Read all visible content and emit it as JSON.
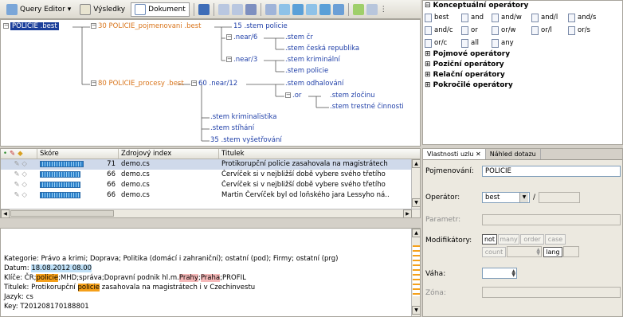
{
  "toolbar": {
    "tabs": [
      {
        "label": "Query Editor ▾",
        "icon": "query-editor-icon"
      },
      {
        "label": "Výsledky",
        "icon": "results-icon"
      },
      {
        "label": "Dokument",
        "icon": "document-icon"
      }
    ],
    "icons": [
      "save-icon",
      "expand-icon",
      "collapse-icon",
      "flag-icon",
      "node-icon",
      "arrow-left-icon",
      "arrow-right-icon",
      "arrow-up-icon",
      "arrow-down-icon",
      "insert-icon",
      "edit-icon",
      "grid-icon",
      "more-icon"
    ]
  },
  "tree": {
    "root": "POLICIE .best",
    "n1": "30 POLICIE_pojmenovani .best",
    "n1a": "15 .stem policie",
    "n1b": ".near/6",
    "n1b1": ".stem čr",
    "n1b2": ".stem česká republika",
    "n1c": ".near/3",
    "n1c1": ".stem kriminální",
    "n1c2": ".stem policie",
    "n2": "80 POLICIE_procesy .best",
    "n2a": "60 .near/12",
    "n2a1": ".stem odhalování",
    "n2a2": ".or",
    "n2a2a": ".stem zločinu",
    "n2a2b": ".stem trestné činnosti",
    "n2b": ".stem kriminalistika",
    "n2c": ".stem stíhání",
    "n2d": "35 .stem vyšetřování"
  },
  "grid": {
    "headers": {
      "score": "Skóre",
      "source": "Zdrojový index",
      "title": "Titulek"
    },
    "rows": [
      {
        "score": "71",
        "source": "demo.cs",
        "title": "Protikorupční policie zasahovala na magistrátech",
        "score_level": 0.71
      },
      {
        "score": "66",
        "source": "demo.cs",
        "title": "Červíček si v nejbližší době vybere svého třetího",
        "score_level": 0.66
      },
      {
        "score": "66",
        "source": "demo.cs",
        "title": "Červíček si v nejbližší době vybere svého třetího",
        "score_level": 0.66
      },
      {
        "score": "66",
        "source": "demo.cs",
        "title": "Martin Červíček byl od loňského jara Lessyho ná..",
        "score_level": 0.66
      }
    ]
  },
  "detail": {
    "kategorie": "Kategorie: Právo a krimi; Doprava; Politika (domácí i zahraniční); ostatní (pod); Firmy; ostatní (prg)",
    "datum_label": "Datum: ",
    "datum_value": "18.08.2012 08.00",
    "klice_label": "Klíče: ČR;",
    "klice_hl1": "policie",
    "klice_mid": ";MHD;správa;Dopravní podnik hl.m.",
    "klice_hl2": "Prahy",
    "klice_sep": ";",
    "klice_hl3": "Praha",
    "klice_end": ";PROFIL",
    "titulek_pre": "Titulek: Protikorupční ",
    "titulek_hl": "policie",
    "titulek_post": " zasahovala na magistrátech i v Czechinvestu",
    "jazyk": "Jazyk: cs",
    "key": "Key: T201208170188801"
  },
  "operators": {
    "sections": [
      {
        "label": "Konceptuální operátory",
        "toggle": "⊟"
      },
      {
        "label": "Pojmové operátory",
        "toggle": "⊞"
      },
      {
        "label": "Poziční operátory",
        "toggle": "⊞"
      },
      {
        "label": "Relační operátory",
        "toggle": "⊞"
      },
      {
        "label": "Pokročilé operátory",
        "toggle": "⊞"
      }
    ],
    "items": [
      [
        "best",
        "and",
        "and/w",
        "and/l",
        "and/s"
      ],
      [
        "and/c",
        "or",
        "or/w",
        "or/l",
        "or/s"
      ],
      [
        "or/c",
        "all",
        "any"
      ]
    ]
  },
  "props": {
    "tabs": [
      "Vlastnosti uzlu ✕",
      "Náhled dotazu"
    ],
    "naming_label": "Pojmenování:",
    "naming_value": "POLICIE",
    "operator_label": "Operátor:",
    "operator_value": "best",
    "operator_slash": "/",
    "params_label": "Parametr:",
    "modifiers_label": "Modifikátory:",
    "mod_buttons": [
      "not",
      "many",
      "order",
      "case"
    ],
    "count_label": "count",
    "lang_label": "lang",
    "weight_label": "Váha:",
    "zone_label": "Zóna:"
  }
}
